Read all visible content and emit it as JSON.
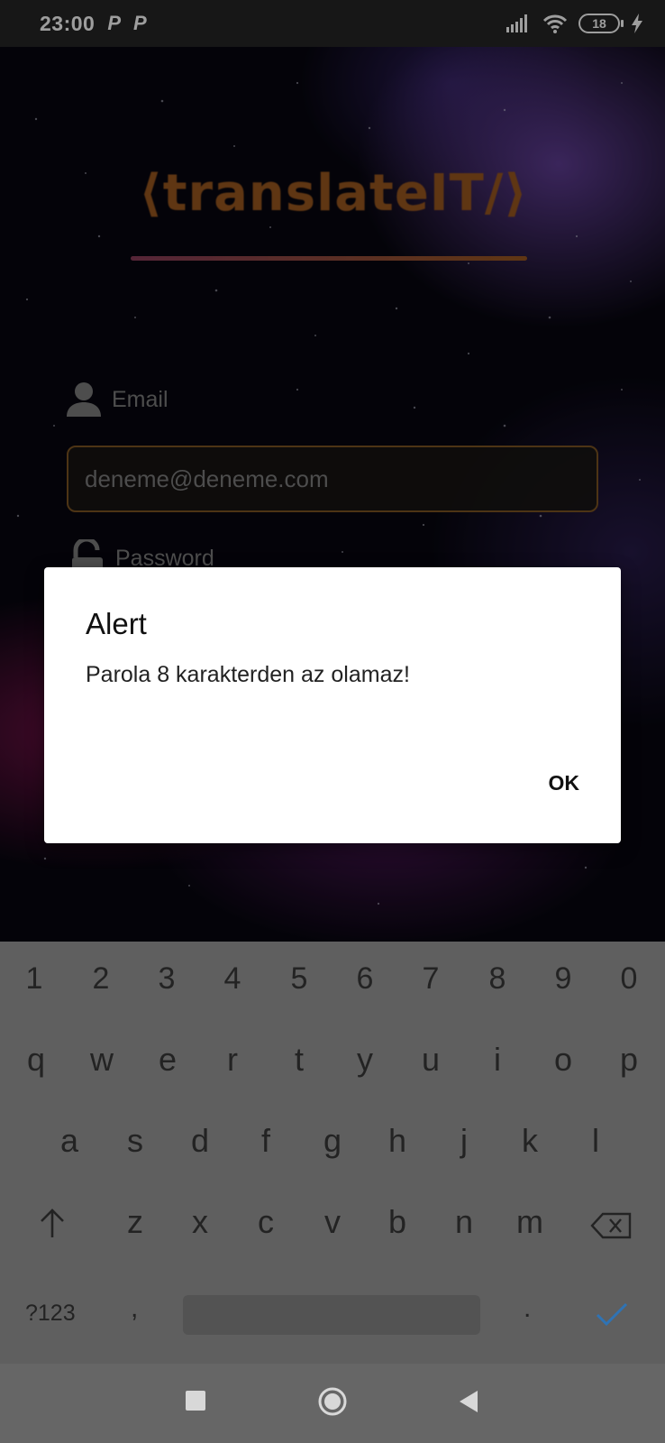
{
  "status_bar": {
    "time": "23:00",
    "app_badges": [
      "P",
      "P"
    ],
    "battery": "18"
  },
  "app": {
    "logo_text": "⟨translateIT/⟩",
    "email_label": "Email",
    "email_value": "deneme@deneme.com",
    "password_label": "Password"
  },
  "dialog": {
    "title": "Alert",
    "message": "Parola 8 karakterden az olamaz!",
    "ok_label": "OK"
  },
  "keyboard": {
    "row_numbers": [
      "1",
      "2",
      "3",
      "4",
      "5",
      "6",
      "7",
      "8",
      "9",
      "0"
    ],
    "row_top": [
      "q",
      "w",
      "e",
      "r",
      "t",
      "y",
      "u",
      "i",
      "o",
      "p"
    ],
    "row_middle": [
      "a",
      "s",
      "d",
      "f",
      "g",
      "h",
      "j",
      "k",
      "l"
    ],
    "row_bottom": [
      "z",
      "x",
      "c",
      "v",
      "b",
      "n",
      "m"
    ],
    "symbols_label": "?123",
    "comma": ",",
    "period": ".",
    "shift_icon": "shift-arrow-icon",
    "backspace_icon": "backspace-icon",
    "done_icon": "check-icon"
  },
  "nav_bar": {
    "icons": [
      "recent-apps-square-icon",
      "home-circle-icon",
      "back-triangle-icon"
    ]
  },
  "colors": {
    "accent_orange": "#9a5820",
    "done_blue": "#2f73b4",
    "keyboard_bg": "#5f5f5f"
  }
}
